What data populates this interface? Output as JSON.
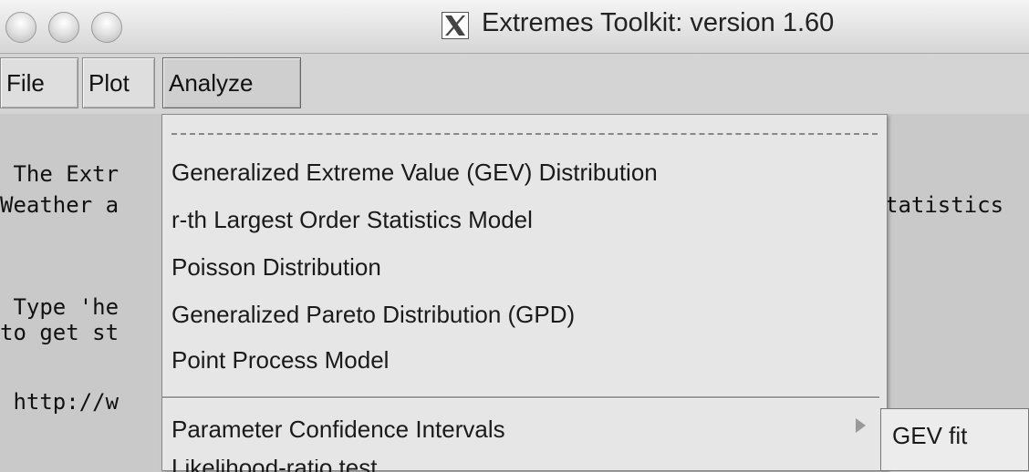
{
  "window": {
    "title": "Extremes Toolkit: version 1.60",
    "app_icon": "x11-icon",
    "buttons": [
      "close-button",
      "minimize-button",
      "zoom-button"
    ]
  },
  "menubar": {
    "items": [
      {
        "label": "File"
      },
      {
        "label": "Plot"
      },
      {
        "label": "Analyze"
      }
    ]
  },
  "console": {
    "lines": [
      " The Extr",
      "Weather a",
      "tatistics",
      " Type 'he",
      "to get st",
      " http://w"
    ]
  },
  "analyze_menu": {
    "items": [
      {
        "label": "Generalized Extreme Value (GEV) Distribution"
      },
      {
        "label": "r-th Largest Order Statistics Model"
      },
      {
        "label": "Poisson Distribution"
      },
      {
        "label": "Generalized Pareto Distribution (GPD)"
      },
      {
        "label": "Point Process Model"
      },
      {
        "label": "Parameter Confidence Intervals",
        "has_submenu": true
      },
      {
        "label": "Likelihood-ratio test"
      }
    ]
  },
  "submenu": {
    "items": [
      {
        "label": "GEV fit"
      }
    ]
  }
}
